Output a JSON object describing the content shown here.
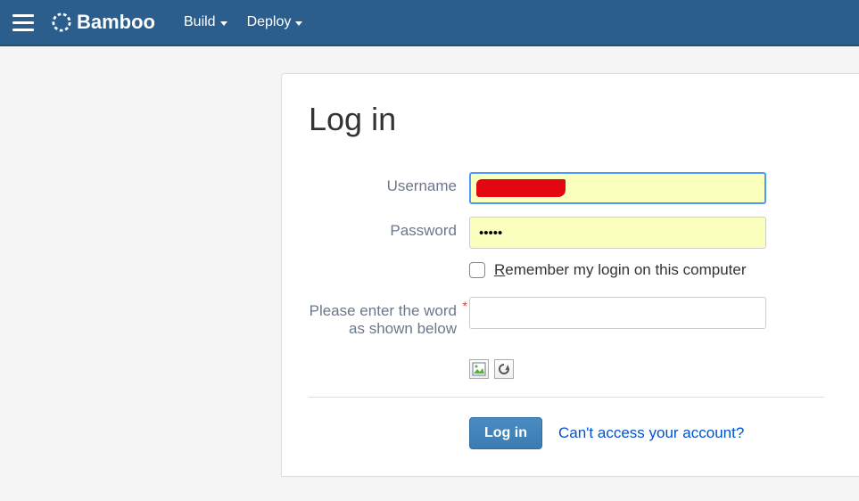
{
  "header": {
    "brand": "Bamboo",
    "nav": [
      {
        "label": "Build"
      },
      {
        "label": "Deploy"
      }
    ]
  },
  "page": {
    "title": "Log in"
  },
  "form": {
    "username": {
      "label": "Username",
      "value": ""
    },
    "password": {
      "label": "Password",
      "value": "•••••"
    },
    "remember": {
      "label_prefix": "R",
      "label_rest": "emember my login on this computer"
    },
    "captcha": {
      "label": "Please enter the word as shown below",
      "value": ""
    }
  },
  "actions": {
    "submit": "Log in",
    "forgot": "Can't access your account?"
  }
}
